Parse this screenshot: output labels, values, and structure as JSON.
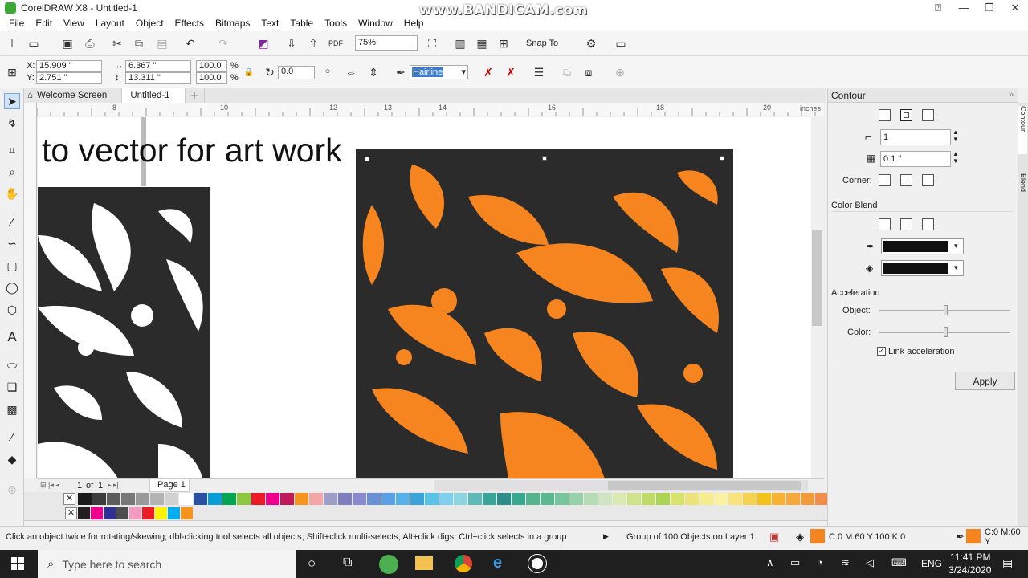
{
  "app": {
    "title": "CorelDRAW X8 - Untitled-1",
    "watermark": "www.BANDICAM.com"
  },
  "menu": [
    "File",
    "Edit",
    "View",
    "Layout",
    "Object",
    "Effects",
    "Bitmaps",
    "Text",
    "Table",
    "Tools",
    "Window",
    "Help"
  ],
  "toolbar": {
    "zoom": "75%",
    "snap_to": "Snap To"
  },
  "property_bar": {
    "x_label": "X:",
    "x": "15.909 \"",
    "y_label": "Y:",
    "y": "2.751 \"",
    "width": "6.367 \"",
    "height": "13.311 \"",
    "scale_x": "100.0",
    "scale_y": "100.0",
    "pct": "%",
    "rotation": "0.0",
    "outline": "Hairline"
  },
  "doc_tabs": [
    "Welcome Screen",
    "Untitled-1"
  ],
  "ruler": {
    "ticks": [
      "8",
      "10",
      "12",
      "13",
      "14",
      "16",
      "18",
      "20"
    ],
    "unit": "inches"
  },
  "canvas": {
    "text": "to vector for art work"
  },
  "page_nav": {
    "current": "1",
    "of": "of",
    "total": "1",
    "page_label": "Page 1"
  },
  "docker": {
    "title": "Contour",
    "steps": "1",
    "offset": "0.1 \"",
    "corner_label": "Corner:",
    "color_blend_label": "Color Blend",
    "acceleration_label": "Acceleration",
    "object_label": "Object:",
    "color_label": "Color:",
    "link_label": "Link acceleration",
    "apply_label": "Apply",
    "side_tabs": [
      "Contour",
      "Blend"
    ]
  },
  "status": {
    "hint": "Click an object twice for rotating/skewing; dbl-clicking tool selects all objects; Shift+click multi-selects; Alt+click digs; Ctrl+click selects in a group",
    "selection": "Group of 100 Objects on Layer 1",
    "fill": "C:0 M:60 Y:100 K:0",
    "outline": "C:0 M:60 Y"
  },
  "taskbar": {
    "search": "Type here to search",
    "time": "11:41 PM",
    "date": "3/24/2020",
    "lang": "ENG"
  },
  "colors": {
    "orange": "#f7851f",
    "dark": "#2b2b2b",
    "accent": "#2e74d1"
  },
  "palette_row1": [
    "#1a1a1a",
    "#3d3d3d",
    "#5c5c5c",
    "#787878",
    "#999",
    "#b3b3b3",
    "#d1d1d1",
    "#fff",
    "#2b4fa3",
    "#0a9ed9",
    "#00a651",
    "#8dc63f",
    "#ed1c24",
    "#ec008c",
    "#c2185b",
    "#f7941d",
    "#f2a6a6",
    "#9e9ec9",
    "#7f7fbf",
    "#8a8ad0",
    "#6b8fd6",
    "#5aa0e6",
    "#57b0e8",
    "#3ba3d9",
    "#59c3e8",
    "#7fd0ef",
    "#8fd5e0",
    "#60b9b9",
    "#3aa398",
    "#2c8f8a",
    "#38a88f",
    "#56b390",
    "#5bb88e",
    "#77c49d",
    "#98d0a9",
    "#b4dcb5",
    "#cde5c1",
    "#dbe9b2",
    "#cfe28c",
    "#bfdb6a",
    "#aed455",
    "#d7e36d",
    "#ece47a",
    "#f6ee8e",
    "#fbf1a2",
    "#f7e27b",
    "#f5d34e",
    "#f3c21b",
    "#f9b233",
    "#f6a93b",
    "#f39a3d",
    "#f08e4a",
    "#ee7f56",
    "#ec6f67",
    "#e85c7a"
  ],
  "palette_row2": [
    "#231f20",
    "#ec008c",
    "#2e3192",
    "#4d4d4d",
    "#f49ac1",
    "#ed1c24",
    "#fff200",
    "#00aeef",
    "#f7941d"
  ]
}
